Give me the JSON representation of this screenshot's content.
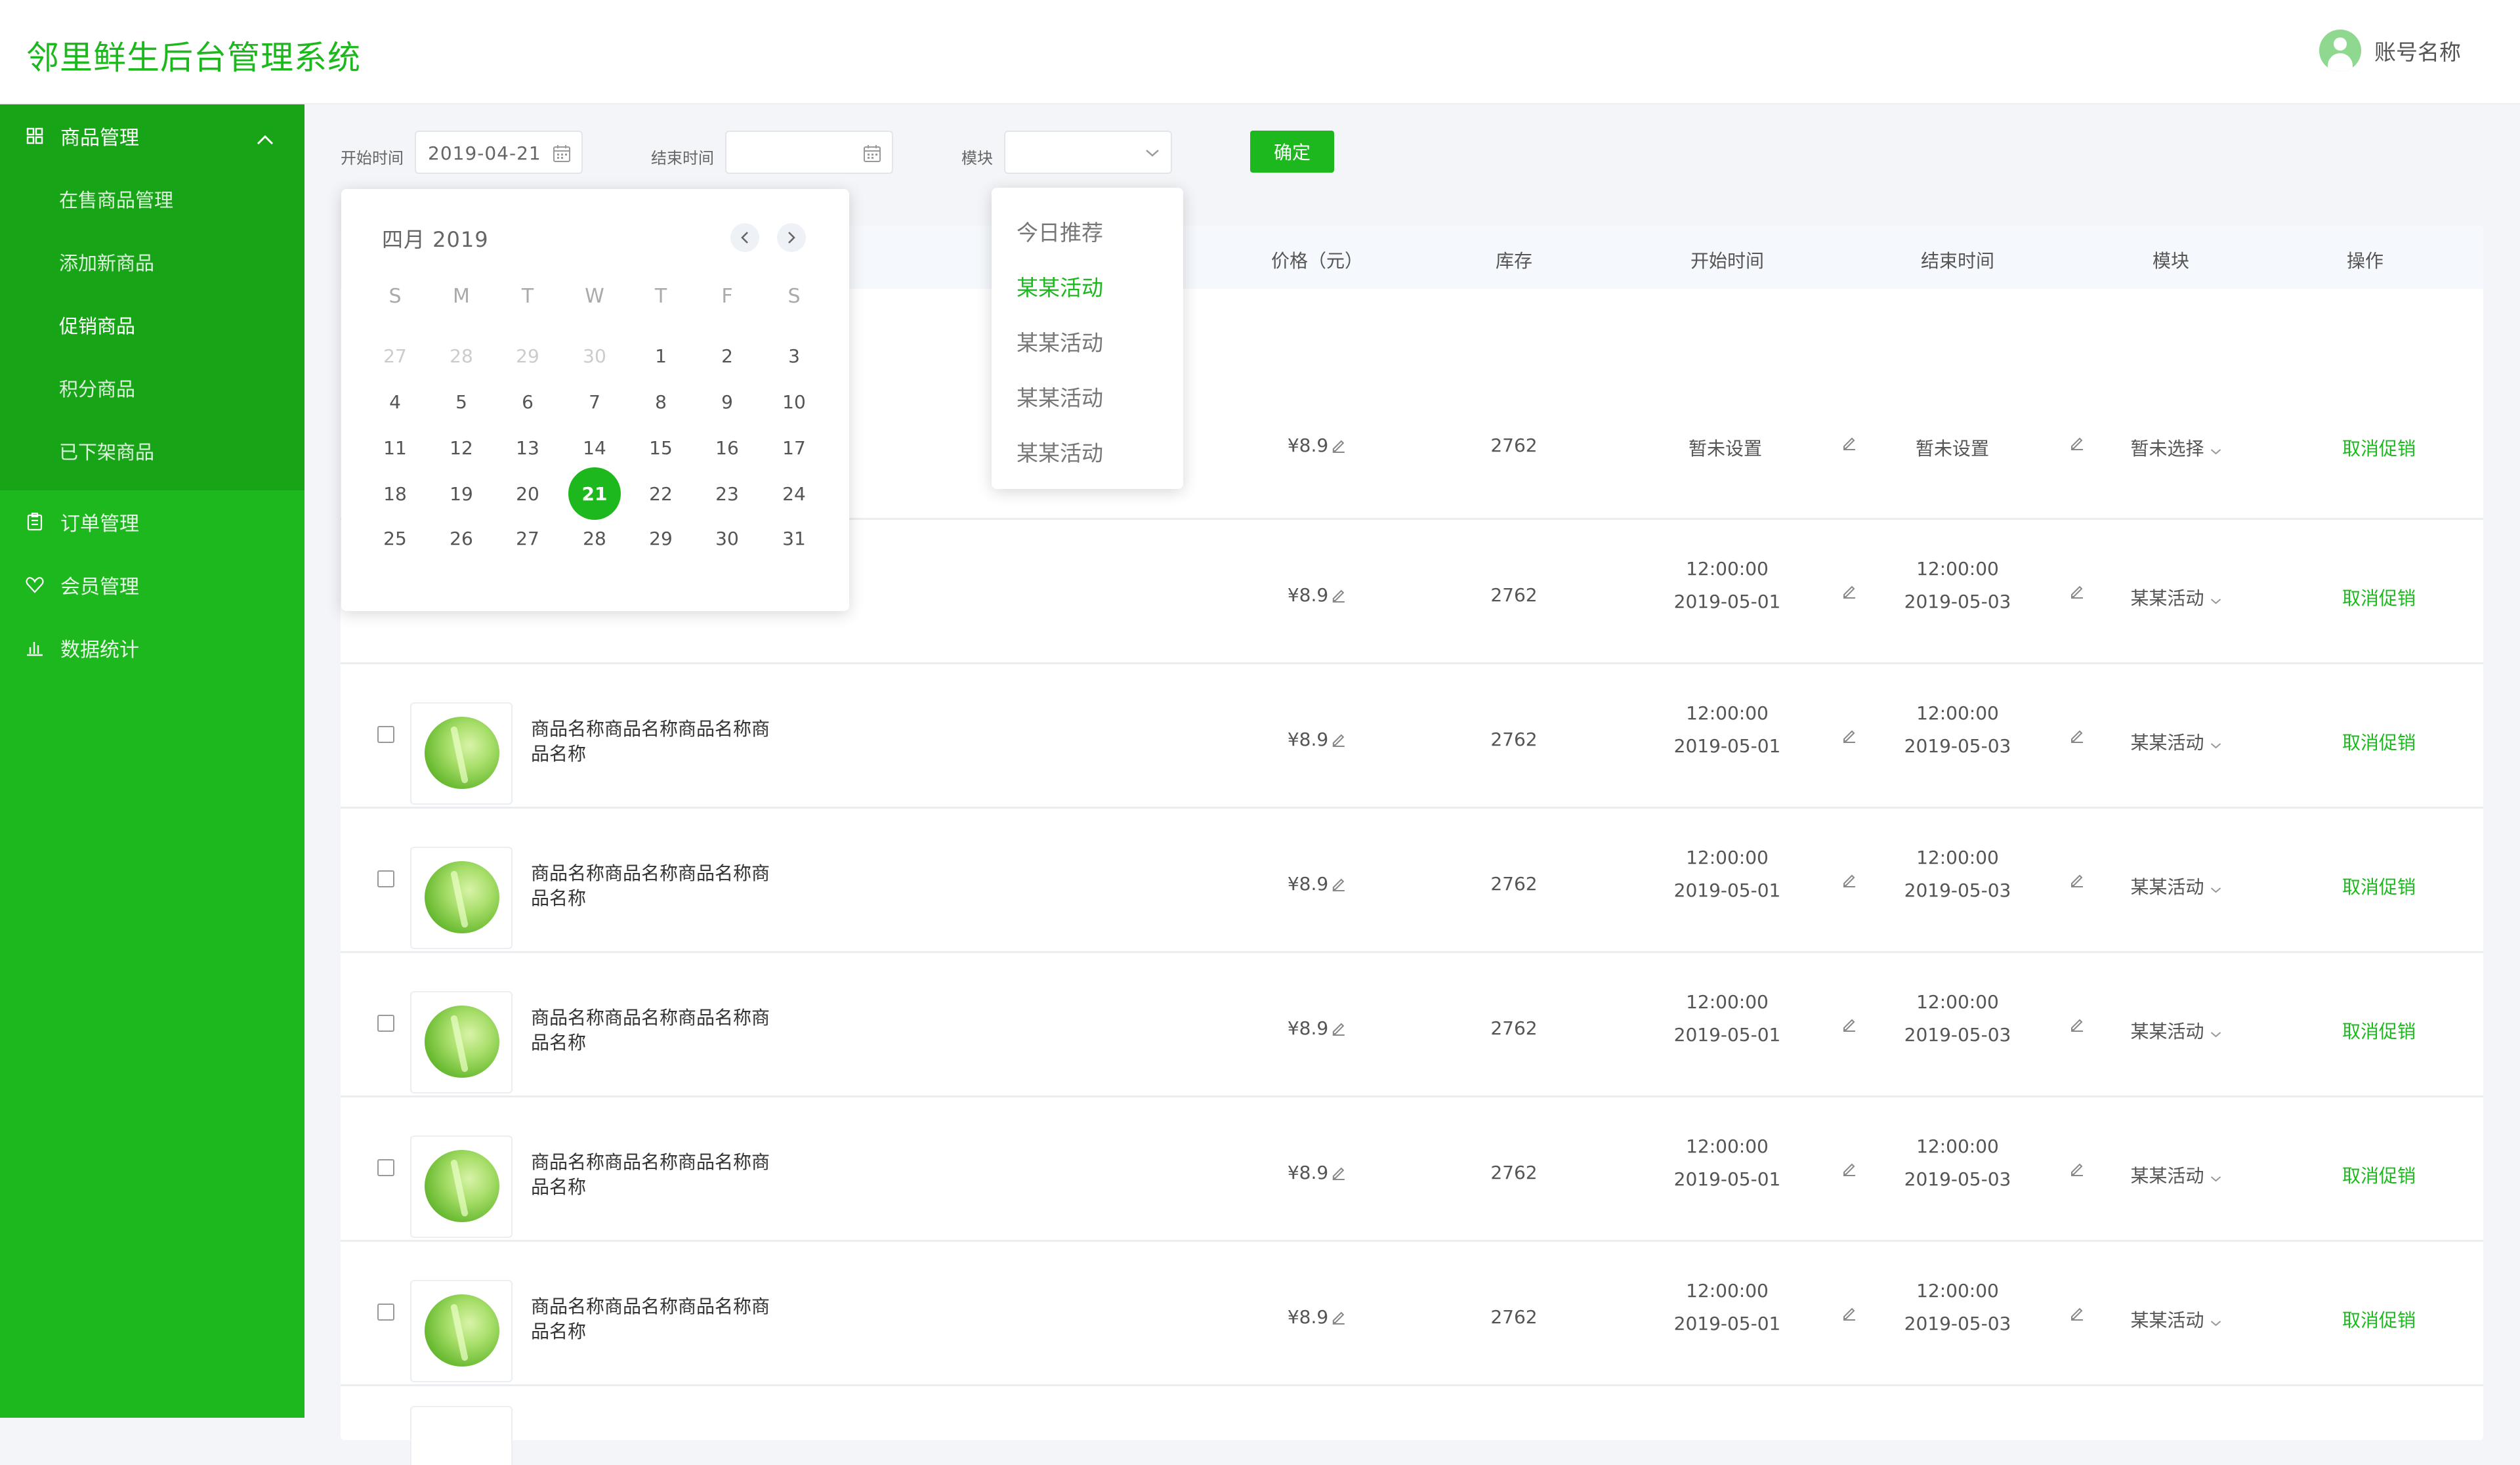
{
  "app": {
    "title": "邻里鲜生后台管理系统"
  },
  "account": {
    "name": "账号名称"
  },
  "sidebar": {
    "group": {
      "label": "商品管理"
    },
    "sub_items": [
      {
        "label": "在售商品管理"
      },
      {
        "label": "添加新商品"
      },
      {
        "label": "促销商品"
      },
      {
        "label": "积分商品"
      },
      {
        "label": "已下架商品"
      }
    ],
    "items": [
      {
        "label": "订单管理"
      },
      {
        "label": "会员管理"
      },
      {
        "label": "数据统计"
      }
    ]
  },
  "filters": {
    "start_label": "开始时间",
    "start_value": "2019-04-21",
    "end_label": "结束时间",
    "end_value": "",
    "module_label": "模块",
    "module_value": "",
    "confirm": "确定"
  },
  "datepicker": {
    "title": "四月 2019",
    "weekdays": [
      "S",
      "M",
      "T",
      "W",
      "T",
      "F",
      "S"
    ],
    "weeks": [
      [
        "27",
        "28",
        "29",
        "30",
        "1",
        "2",
        "3"
      ],
      [
        "4",
        "5",
        "6",
        "7",
        "8",
        "9",
        "10"
      ],
      [
        "11",
        "12",
        "13",
        "14",
        "15",
        "16",
        "17"
      ],
      [
        "18",
        "19",
        "20",
        "21",
        "22",
        "23",
        "24"
      ],
      [
        "25",
        "26",
        "27",
        "28",
        "29",
        "30",
        "31"
      ]
    ],
    "selected": "21"
  },
  "module_dropdown": {
    "options": [
      "今日推荐",
      "某某活动",
      "某某活动",
      "某某活动",
      "某某活动"
    ],
    "active_index": 1
  },
  "table": {
    "headers": {
      "price": "价格（元）",
      "stock": "库存",
      "start": "开始时间",
      "end": "结束时间",
      "module": "模块",
      "action": "操作"
    },
    "rows": [
      {
        "name": "",
        "price": "¥8.9",
        "stock": "2762",
        "start_time": "",
        "start_date": "暂未设置",
        "end_time": "",
        "end_date": "暂未设置",
        "module": "暂未选择",
        "action": "取消促销"
      },
      {
        "name": "",
        "price": "¥8.9",
        "stock": "2762",
        "start_time": "12:00:00",
        "start_date": "2019-05-01",
        "end_time": "12:00:00",
        "end_date": "2019-05-03",
        "module": "某某活动",
        "action": "取消促销"
      },
      {
        "name": "商品名称商品名称商品名称商品名称",
        "price": "¥8.9",
        "stock": "2762",
        "start_time": "12:00:00",
        "start_date": "2019-05-01",
        "end_time": "12:00:00",
        "end_date": "2019-05-03",
        "module": "某某活动",
        "action": "取消促销"
      },
      {
        "name": "商品名称商品名称商品名称商品名称",
        "price": "¥8.9",
        "stock": "2762",
        "start_time": "12:00:00",
        "start_date": "2019-05-01",
        "end_time": "12:00:00",
        "end_date": "2019-05-03",
        "module": "某某活动",
        "action": "取消促销"
      },
      {
        "name": "商品名称商品名称商品名称商品名称",
        "price": "¥8.9",
        "stock": "2762",
        "start_time": "12:00:00",
        "start_date": "2019-05-01",
        "end_time": "12:00:00",
        "end_date": "2019-05-03",
        "module": "某某活动",
        "action": "取消促销"
      },
      {
        "name": "商品名称商品名称商品名称商品名称",
        "price": "¥8.9",
        "stock": "2762",
        "start_time": "12:00:00",
        "start_date": "2019-05-01",
        "end_time": "12:00:00",
        "end_date": "2019-05-03",
        "module": "某某活动",
        "action": "取消促销"
      },
      {
        "name": "商品名称商品名称商品名称商品名称",
        "price": "¥8.9",
        "stock": "2762",
        "start_time": "12:00:00",
        "start_date": "2019-05-01",
        "end_time": "12:00:00",
        "end_date": "2019-05-03",
        "module": "某某活动",
        "action": "取消促销"
      }
    ]
  },
  "colors": {
    "brand": "#1db81d",
    "sidebar": "#1db81d",
    "sidebar_group": "#17a517"
  },
  "icons": [
    "user-avatar-icon",
    "grid-icon",
    "chevron-up-icon",
    "clipboard-icon",
    "heart-icon",
    "bar-chart-icon",
    "calendar-icon",
    "chevron-down-icon",
    "chevron-left-icon",
    "chevron-right-icon",
    "edit-pencil-icon",
    "cabbage-image"
  ]
}
